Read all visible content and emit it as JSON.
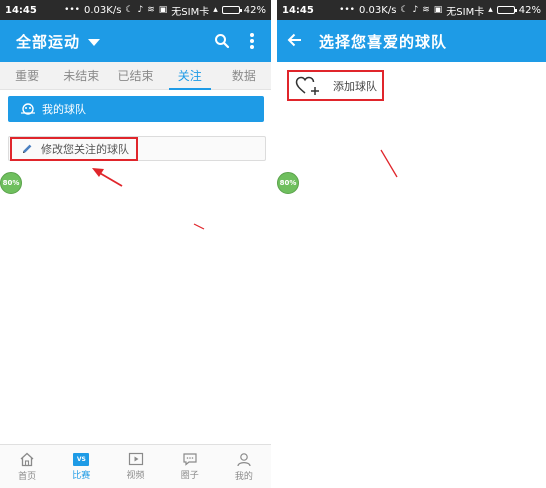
{
  "status_bar": {
    "time": "14:45",
    "network_speed": "0.03K/s",
    "sim": "无SIM卡",
    "battery": "42%",
    "battery_level": 0.42
  },
  "left_screen": {
    "app_bar": {
      "title": "全部运动",
      "dropdown_icon": "triangle-down-icon",
      "search_icon": "search-icon",
      "more_icon": "more-vertical-icon"
    },
    "tabs": [
      {
        "label": "重要",
        "active": false
      },
      {
        "label": "未结束",
        "active": false
      },
      {
        "label": "已结束",
        "active": false
      },
      {
        "label": "关注",
        "active": true
      },
      {
        "label": "数据",
        "active": false
      }
    ],
    "my_team": {
      "label": "我的球队",
      "icon": "team-icon"
    },
    "modify": {
      "label": "修改您关注的球队",
      "icon": "pencil-icon"
    },
    "badge": "80%",
    "bottom_nav": [
      {
        "label": "首页",
        "icon": "home-icon",
        "active": false
      },
      {
        "label": "比赛",
        "icon": "vs-icon",
        "icon_text": "VS",
        "active": true
      },
      {
        "label": "视频",
        "icon": "video-play-icon",
        "active": false
      },
      {
        "label": "圈子",
        "icon": "chat-icon",
        "active": false
      },
      {
        "label": "我的",
        "icon": "user-icon",
        "active": false
      }
    ]
  },
  "right_screen": {
    "app_bar": {
      "title": "选择您喜爱的球队",
      "back_icon": "arrow-left-icon"
    },
    "add_team": {
      "label": "添加球队",
      "icon": "heart-plus-icon"
    },
    "badge": "80%"
  },
  "colors": {
    "accent": "#1e9be6",
    "annotation_red": "#e0252b",
    "status_bar": "#2b2b2b"
  }
}
